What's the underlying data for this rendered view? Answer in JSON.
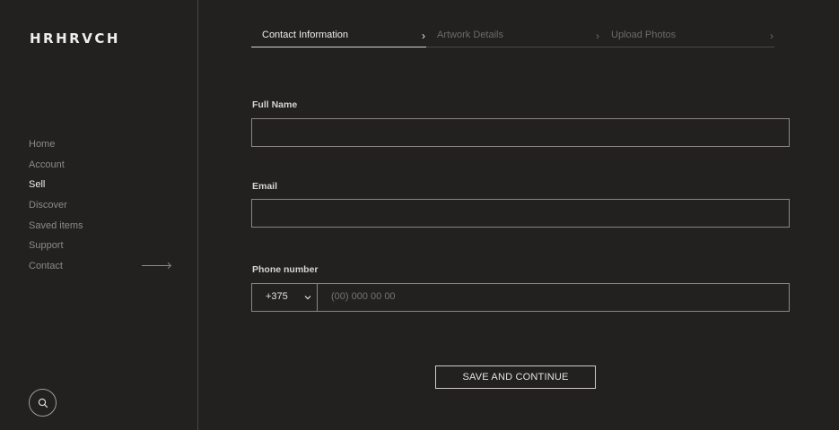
{
  "brand": {
    "logo_text": "HRHRVCH"
  },
  "nav": {
    "items": [
      {
        "label": "Home"
      },
      {
        "label": "Account"
      },
      {
        "label": "Sell"
      },
      {
        "label": "Discover"
      },
      {
        "label": "Saved items"
      },
      {
        "label": "Support"
      },
      {
        "label": "Contact"
      }
    ],
    "active": "Sell"
  },
  "steps": [
    {
      "label": "Contact Information",
      "active": true
    },
    {
      "label": "Artwork Details",
      "active": false
    },
    {
      "label": "Upload Photos",
      "active": false
    }
  ],
  "form": {
    "full_name": {
      "label": "Full Name",
      "value": ""
    },
    "email": {
      "label": "Email",
      "value": ""
    },
    "phone": {
      "label": "Phone number",
      "country_code": "+375",
      "placeholder": "(00) 000 00 00"
    },
    "submit_label": "SAVE AND CONTINUE"
  },
  "icons": {
    "search": "search-icon",
    "step_chevron": "chevron-right-icon",
    "select_chevron": "chevron-down-icon",
    "contact_arrow": "arrow-right-icon"
  },
  "colors": {
    "background": "#222120",
    "text": "#e8e6e2",
    "muted": "#8d8a85",
    "border": "#8a8782"
  }
}
